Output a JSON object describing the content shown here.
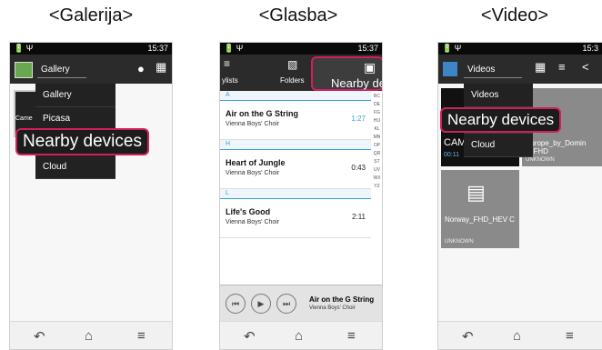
{
  "titles": {
    "galerija": "<Galerija>",
    "glasba": "<Glasba>",
    "video": "<Video>"
  },
  "status": {
    "time": "15:37",
    "time_cut": "15:3",
    "icons": "🔋 Ψ"
  },
  "callout": {
    "text": "Nearby devices",
    "text_cut": "Nearby devic"
  },
  "gallery": {
    "spinner": "Gallery",
    "menu": [
      "Gallery",
      "Picasa",
      "Cloud"
    ],
    "thumb_label": "Came"
  },
  "music": {
    "tabs": {
      "playlists": "ylists",
      "folders": "Folders"
    },
    "sections": [
      "A",
      "H",
      "L"
    ],
    "songs": [
      {
        "title": "Air on the G String",
        "artist": "Vienna Boys' Choir",
        "duration": "1:27"
      },
      {
        "title": "Heart of Jungle",
        "artist": "Vienna Boys' Choir",
        "duration": "0:43"
      },
      {
        "title": "Life's Good",
        "artist": "Vienna Boys' Choir",
        "duration": "2:11"
      }
    ],
    "index": "BCDEFGHIJKLMNOPQRSTUVWXYZ",
    "now_playing": {
      "title": "Air on the G String",
      "artist": "Vienna Boys' Choir"
    }
  },
  "video": {
    "spinner": "Videos",
    "menu": [
      "Videos",
      "Cloud"
    ],
    "items": [
      {
        "name": "CAM",
        "sub": "00:11"
      },
      {
        "name": "Europe_by_Domin c_FHD",
        "sub": "UNKNOWN"
      },
      {
        "name": "Norway_FHD_HEV C",
        "sub": "UNKNOWN"
      }
    ]
  },
  "colors": {
    "accent": "#d01f5f",
    "actionbar": "#2b2b2b",
    "highlight": "#3aa0d3"
  }
}
